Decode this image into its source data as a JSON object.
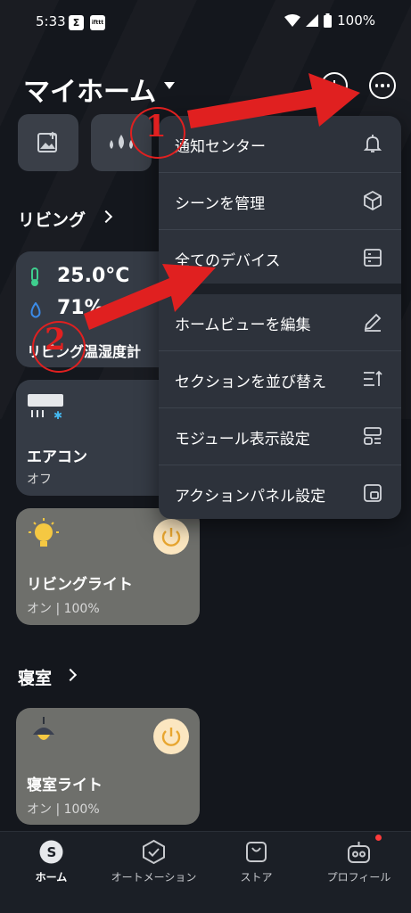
{
  "status_bar": {
    "time": "5:33",
    "app_icon_1": "Σ",
    "app_icon_2": "ifttt",
    "battery": "100%"
  },
  "header": {
    "title": "マイホーム",
    "add_icon": "plus-circle-icon",
    "more_icon": "more-circle-icon"
  },
  "quick_tiles": [
    {
      "icon": "image-upload-icon"
    },
    {
      "icon": "water-drops-icon"
    }
  ],
  "sections": [
    {
      "title": "リビング"
    },
    {
      "title": "寝室"
    }
  ],
  "devices": {
    "sensor": {
      "temperature": "25.0°C",
      "humidity": "71%",
      "name": "リビング温湿度計"
    },
    "aircon": {
      "name": "エアコン",
      "status": "オフ"
    },
    "living_light": {
      "name": "リビングライト",
      "status": "オン | 100%"
    },
    "bedroom_light": {
      "name": "寝室ライト",
      "status": "オン | 100%"
    }
  },
  "menu": {
    "items": [
      {
        "label": "通知センター",
        "icon": "bell-icon"
      },
      {
        "label": "シーンを管理",
        "icon": "cube-icon"
      },
      {
        "label": "全てのデバイス",
        "icon": "devices-icon"
      },
      {
        "label": "ホームビューを編集",
        "icon": "pencil-icon"
      },
      {
        "label": "セクションを並び替え",
        "icon": "sort-icon"
      },
      {
        "label": "モジュール表示設定",
        "icon": "layout-icon"
      },
      {
        "label": "アクションパネル設定",
        "icon": "panel-icon"
      }
    ]
  },
  "annotations": {
    "step_1": "1",
    "step_2": "2",
    "color": "#e02020"
  },
  "bottom_nav": {
    "items": [
      {
        "label": "ホーム",
        "icon": "home-s-icon",
        "active": true
      },
      {
        "label": "オートメーション",
        "icon": "automation-icon"
      },
      {
        "label": "ストア",
        "icon": "store-icon"
      },
      {
        "label": "プロフィール",
        "icon": "robot-profile-icon"
      }
    ]
  },
  "colors": {
    "background": "#14171d",
    "card": "#353b45",
    "light_card": "#6e6f6b",
    "menu": "#2d323b",
    "power_button": "#fbe6c0",
    "bulb": "#f5c842"
  }
}
